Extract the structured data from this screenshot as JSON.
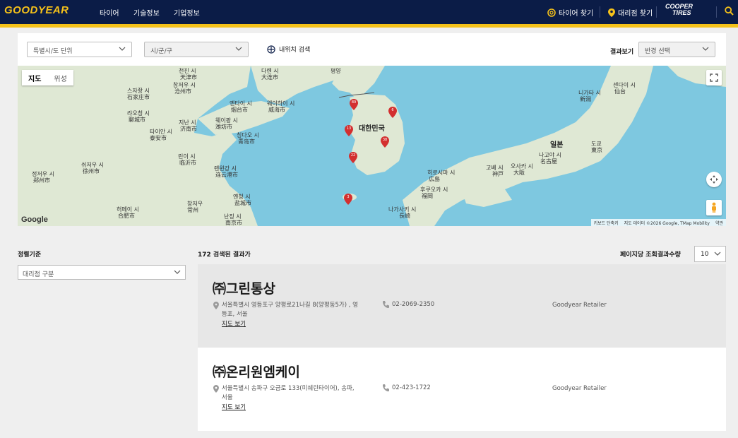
{
  "header": {
    "logo": "GOODYEAR",
    "nav": [
      "타이어",
      "기술정보",
      "기업정보"
    ],
    "find_tire": "타이어 찾기",
    "find_dealer": "대리점 찾기",
    "cooper_line1": "COOPER",
    "cooper_line2": "TIRES"
  },
  "filters": {
    "province": "특별시/도 단위",
    "city": "시/군/구",
    "locate_label": "내위치 검색",
    "results_label": "결과보기",
    "radius": "반경 선택"
  },
  "map": {
    "tab_map": "지도",
    "tab_satellite": "위성",
    "country_korea": "대한민국",
    "country_japan": "일본",
    "google": "Google",
    "attribution": [
      "키보드 단축키",
      "지도 데이터 ©2026 Google, TMap Mobility",
      "약관"
    ],
    "labels": [
      "평양",
      "다롄 시",
      "大连市",
      "천진 시",
      "天津市",
      "스자좡 시",
      "石家庄市",
      "창저우 시",
      "沧州市",
      "랴오청 시",
      "聊城市",
      "지난 시",
      "济南市",
      "타이안 시",
      "泰安市",
      "웨이팡 시",
      "潍坊市",
      "옌타이 시",
      "烟台市",
      "웨이하이 시",
      "威海市",
      "칭다오 시",
      "青岛市",
      "린이 시",
      "临沂市",
      "쉬저우 시",
      "徐州市",
      "롄윈강 시",
      "连云港市",
      "옌청 시",
      "盐城市",
      "허페이 시",
      "合肥市",
      "난징 시",
      "南京市",
      "정저우 시",
      "郑州市",
      "창저우",
      "常州",
      "후쿠오카 시",
      "福岡",
      "히로시마 시",
      "広島",
      "고베 시",
      "神戸",
      "오사카 시",
      "大阪",
      "나고야 시",
      "名古屋",
      "도쿄",
      "東京",
      "센다이 시",
      "仙台",
      "니가타 시",
      "新潟",
      "나가사키 시",
      "長崎"
    ],
    "pins": [
      "89",
      "6",
      "13",
      "38",
      "22",
      "3"
    ]
  },
  "sort": {
    "title": "정렬기준",
    "select": "대리점 구분"
  },
  "results": {
    "count": "172 검색된 결과가",
    "per_page_label": "페이지당 조회결과수량",
    "per_page": "10",
    "items": [
      {
        "name": "㈜그린통상",
        "address": "서울특별시 영등포구 양평로21나길 8(양평동5가) , 영등포, 서울",
        "map_link": "지도 보기",
        "phone": "02-2069-2350",
        "type": "Goodyear Retailer"
      },
      {
        "name": "㈜온리원엠케이",
        "address": "서울특별시 송파구 오금로 133(미쉐린타이어), 송파, 서울",
        "map_link": "지도 보기",
        "phone": "02-423-1722",
        "type": "Goodyear Retailer"
      }
    ]
  },
  "colors": {
    "navy": "#0b1c47",
    "yellow": "#f6c21a",
    "water": "#7ec8e0",
    "land": "#dfe8d4",
    "pin": "#d32f2f"
  }
}
